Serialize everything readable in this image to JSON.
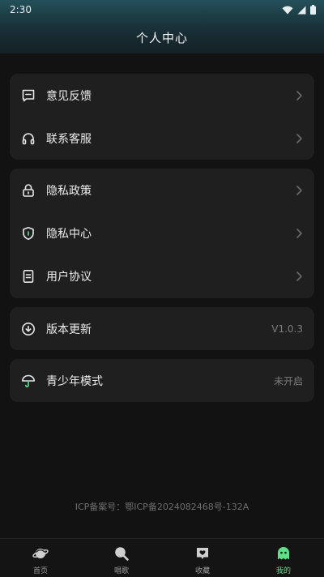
{
  "status_bar": {
    "time": "2:30"
  },
  "header": {
    "title": "个人中心"
  },
  "groups": [
    {
      "items": [
        {
          "label": "意见反馈",
          "icon": "feedback-icon",
          "accessory": "chevron"
        },
        {
          "label": "联系客服",
          "icon": "headset-icon",
          "accessory": "chevron"
        }
      ]
    },
    {
      "items": [
        {
          "label": "隐私政策",
          "icon": "lock-icon",
          "accessory": "chevron"
        },
        {
          "label": "隐私中心",
          "icon": "shield-icon",
          "accessory": "chevron"
        },
        {
          "label": "用户协议",
          "icon": "document-icon",
          "accessory": "chevron"
        }
      ]
    },
    {
      "items": [
        {
          "label": "版本更新",
          "icon": "download-circle-icon",
          "value": "V1.0.3"
        }
      ]
    },
    {
      "items": [
        {
          "label": "青少年模式",
          "icon": "umbrella-icon",
          "value": "未开启"
        }
      ]
    }
  ],
  "footer": {
    "icp": "ICP备案号：鄂ICP备2024082468号-132A"
  },
  "tabbar": {
    "active_color": "#5ee08a",
    "tabs": [
      {
        "label": "首页",
        "icon": "planet-icon",
        "active": false
      },
      {
        "label": "唱歌",
        "icon": "microphone-icon",
        "active": false
      },
      {
        "label": "收藏",
        "icon": "favorite-icon",
        "active": false
      },
      {
        "label": "我的",
        "icon": "ghost-icon",
        "active": true
      }
    ]
  },
  "colors": {
    "accent": "#5ee08a",
    "card": "#1f1f1f",
    "background": "#121212"
  }
}
